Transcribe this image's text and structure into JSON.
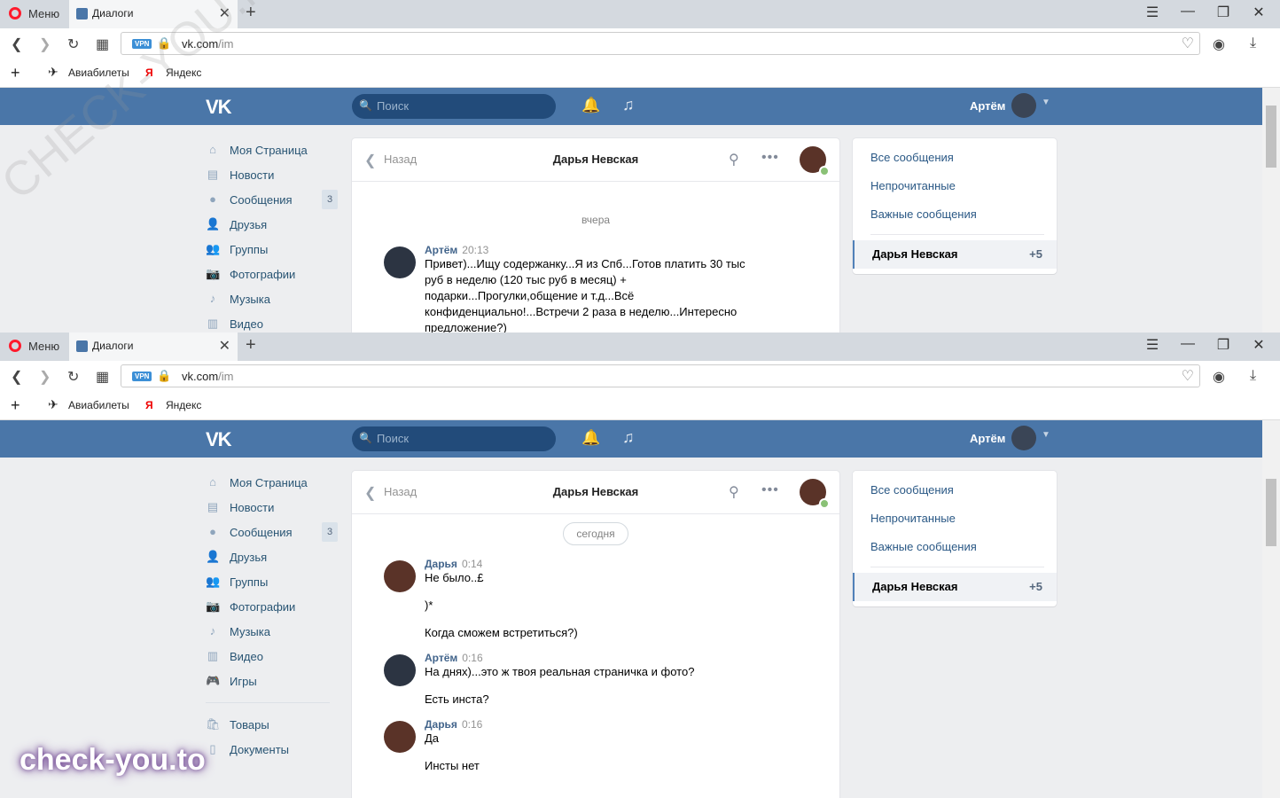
{
  "browser": {
    "menu_label": "Меню",
    "tab_title": "Диалоги",
    "url_host": "vk.com",
    "url_path": "/im",
    "vpn_label": "VPN",
    "bookmarks": [
      "Авиабилеты",
      "Яндекс"
    ]
  },
  "vk_header": {
    "search_placeholder": "Поиск",
    "user_name": "Артём"
  },
  "left_nav": {
    "items": [
      {
        "label": "Моя Страница",
        "icon": "home-icon"
      },
      {
        "label": "Новости",
        "icon": "news-icon"
      },
      {
        "label": "Сообщения",
        "icon": "messages-icon",
        "badge": "3"
      },
      {
        "label": "Друзья",
        "icon": "friend-icon"
      },
      {
        "label": "Группы",
        "icon": "groups-icon"
      },
      {
        "label": "Фотографии",
        "icon": "camera-icon"
      },
      {
        "label": "Музыка",
        "icon": "music-note-icon"
      },
      {
        "label": "Видео",
        "icon": "film-icon"
      },
      {
        "label": "Игры",
        "icon": "gamepad-icon"
      }
    ],
    "items2": [
      {
        "label": "Товары",
        "icon": "bag-icon"
      },
      {
        "label": "Документы",
        "icon": "document-icon"
      }
    ]
  },
  "chat": {
    "back_label": "Назад",
    "peer_name": "Дарья Невская",
    "top": {
      "day": "вчера",
      "message": {
        "author": "Артём",
        "time": "20:13",
        "lines": [
          "Привет)...Ищу содержанку...Я из Спб...Готов платить 30 тыс",
          "руб в неделю (120 тыс руб в месяц) +",
          "подарки...Прогулки,общение и т.д...Всё",
          "конфиденциально!...Встречи 2 раза в неделю...Интересно",
          "предложение?)"
        ]
      }
    },
    "bottom": {
      "day": "сегодня",
      "messages": [
        {
          "author": "Дарья",
          "time": "0:14",
          "lines": [
            "Не было..£",
            ")*",
            "Когда сможем встретиться?)"
          ]
        },
        {
          "author": "Артём",
          "time": "0:16",
          "lines": [
            "На днях)...это ж твоя реальная страничка и фото?",
            "Есть инста?"
          ]
        },
        {
          "author": "Дарья",
          "time": "0:16",
          "lines": [
            "Да",
            "Инсты нет"
          ]
        }
      ]
    }
  },
  "right_panel": {
    "filters": [
      "Все сообщения",
      "Непрочитанные",
      "Важные сообщения"
    ],
    "active_dialog": "Дарья Невская",
    "active_count": "+5"
  },
  "watermark": {
    "bottom": "check-you.to",
    "diagonal": "CHECK-YOU.ME"
  },
  "colors": {
    "vk_blue": "#4a76a8",
    "link": "#2a5885",
    "author": "#42648b",
    "online": "#8ac176"
  }
}
